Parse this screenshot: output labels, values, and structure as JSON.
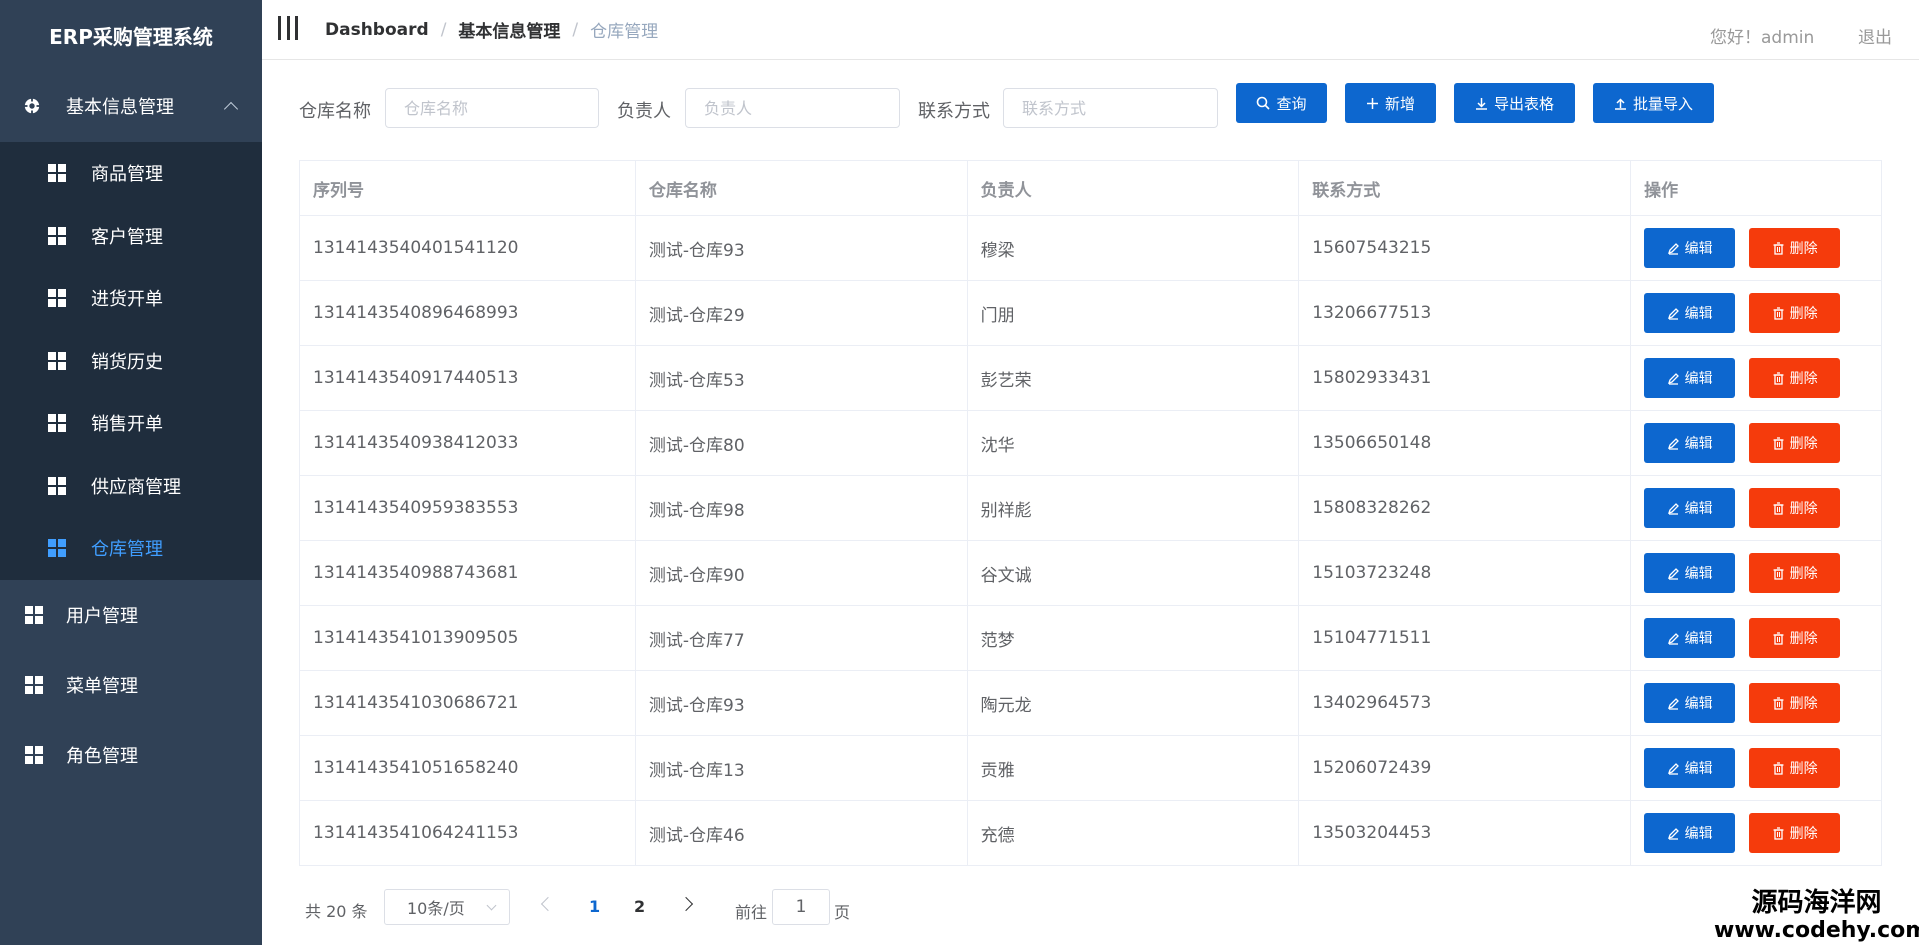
{
  "app": {
    "title": "ERP采购管理系统"
  },
  "sidebar": {
    "group": {
      "label": "基本信息管理",
      "icon": "gear-icon"
    },
    "sub_items": [
      {
        "label": "商品管理",
        "active": false
      },
      {
        "label": "客户管理",
        "active": false
      },
      {
        "label": "进货开单",
        "active": false
      },
      {
        "label": "销货历史",
        "active": false
      },
      {
        "label": "销售开单",
        "active": false
      },
      {
        "label": "供应商管理",
        "active": false
      },
      {
        "label": "仓库管理",
        "active": true
      }
    ],
    "top_items": [
      {
        "label": "用户管理"
      },
      {
        "label": "菜单管理"
      },
      {
        "label": "角色管理"
      }
    ],
    "active_color": "#409eff"
  },
  "header": {
    "breadcrumb": [
      "Dashboard",
      "基本信息管理",
      "仓库管理"
    ],
    "breadcrumb_sep": "/",
    "greeting": "您好！admin",
    "logout": "退出"
  },
  "search": {
    "warehouse_label": "仓库名称",
    "warehouse_placeholder": "仓库名称",
    "manager_label": "负责人",
    "manager_placeholder": "负责人",
    "contact_label": "联系方式",
    "contact_placeholder": "联系方式",
    "query_btn": "查询",
    "add_btn": "新增",
    "export_btn": "导出表格",
    "import_btn": "批量导入"
  },
  "table": {
    "headers": [
      "序列号",
      "仓库名称",
      "负责人",
      "联系方式",
      "操作"
    ],
    "edit_label": "编辑",
    "delete_label": "删除",
    "rows": [
      [
        "1314143540401541120",
        "测试-仓库93",
        "穆梁",
        "15607543215"
      ],
      [
        "1314143540896468993",
        "测试-仓库29",
        "门朋",
        "13206677513"
      ],
      [
        "1314143540917440513",
        "测试-仓库53",
        "彭艺荣",
        "15802933431"
      ],
      [
        "1314143540938412033",
        "测试-仓库80",
        "沈华",
        "13506650148"
      ],
      [
        "1314143540959383553",
        "测试-仓库98",
        "别祥彪",
        "15808328262"
      ],
      [
        "1314143540988743681",
        "测试-仓库90",
        "谷文诚",
        "15103723248"
      ],
      [
        "1314143541013909505",
        "测试-仓库77",
        "范梦",
        "15104771511"
      ],
      [
        "1314143541030686721",
        "测试-仓库93",
        "陶元龙",
        "13402964573"
      ],
      [
        "1314143541051658240",
        "测试-仓库13",
        "贡雅",
        "15206072439"
      ],
      [
        "1314143541064241153",
        "测试-仓库46",
        "充德",
        "13503204453"
      ]
    ],
    "edit_color": "#0d67cf",
    "delete_color": "#f53b0c"
  },
  "pagination": {
    "total": "共 20 条",
    "page_size": "10条/页",
    "pages": [
      "1",
      "2"
    ],
    "current_page": "1",
    "goto_prefix": "前往",
    "goto_value": "1",
    "goto_suffix": "页"
  },
  "watermark": {
    "line1": "源码海洋网",
    "line2": "www.codehy.com"
  }
}
